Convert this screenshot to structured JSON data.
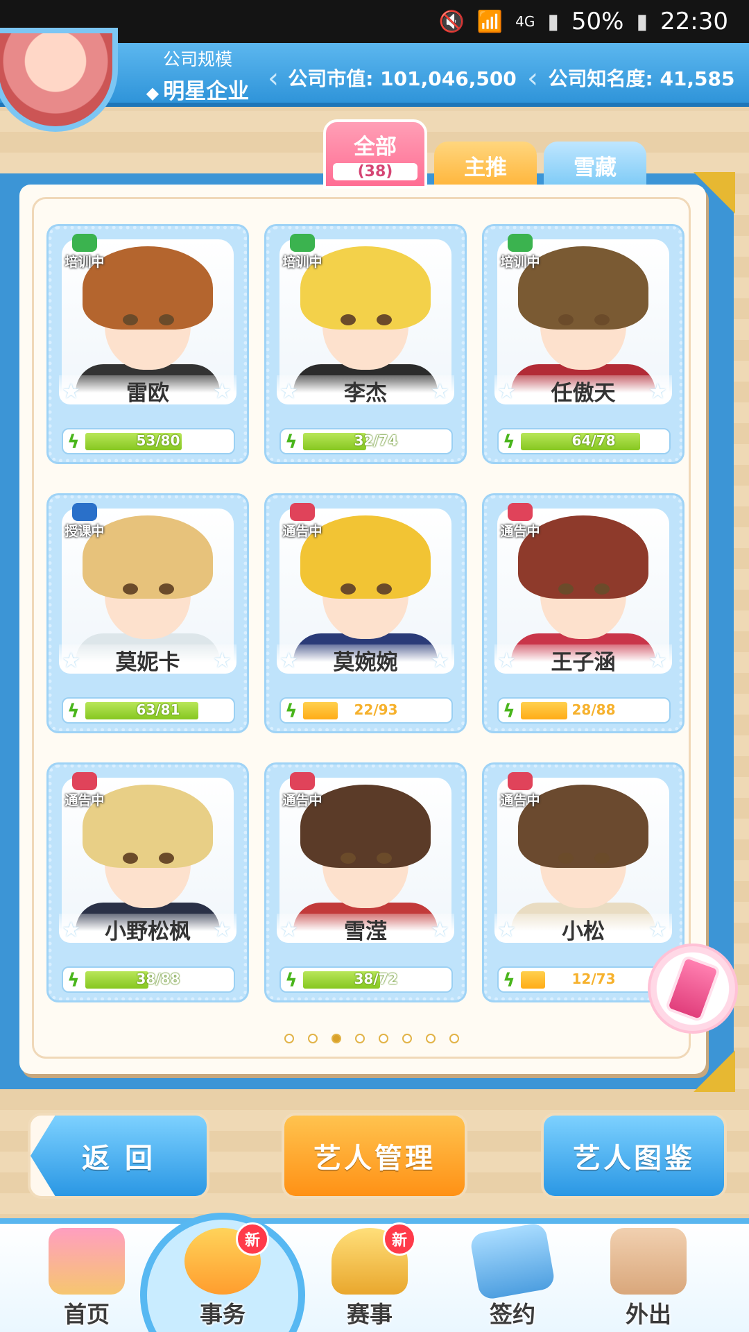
{
  "status_bar": {
    "icons": [
      "mute-icon",
      "wifi-icon",
      "signal-icon",
      "battery-icon"
    ],
    "network": "4G",
    "battery": "50%",
    "time": "22:30"
  },
  "header": {
    "company_scale_label": "公司规模",
    "company_scale_value": "明星企业",
    "market_value": "公司市值: 101,046,500",
    "popularity": "公司知名度: 41,585"
  },
  "tabs": [
    {
      "label": "全部",
      "count": "(38)",
      "active": true
    },
    {
      "label": "主推",
      "active": false
    },
    {
      "label": "雪藏",
      "active": false
    }
  ],
  "artists": [
    {
      "name": "雷欧",
      "status": "培训中",
      "status_type": "training",
      "energy_text": "53/80",
      "energy_fraction": 0.6625,
      "bar": "green",
      "hair": "#b4652e",
      "clothes": "#333333"
    },
    {
      "name": "李杰",
      "status": "培训中",
      "status_type": "training",
      "energy_text": "32/74",
      "energy_fraction": 0.4324,
      "bar": "green",
      "hair": "#f3d14a",
      "clothes": "#2b2b2b"
    },
    {
      "name": "任傲天",
      "status": "培训中",
      "status_type": "training",
      "energy_text": "64/78",
      "energy_fraction": 0.8205,
      "bar": "green",
      "hair": "#7a5a33",
      "clothes": "#b22b36"
    },
    {
      "name": "莫妮卡",
      "status": "授课中",
      "status_type": "teaching",
      "energy_text": "63/81",
      "energy_fraction": 0.7778,
      "bar": "green",
      "hair": "#e7c27b",
      "clothes": "#dde6ea"
    },
    {
      "name": "莫婉婉",
      "status": "通告中",
      "status_type": "notice",
      "energy_text": "22/93",
      "energy_fraction": 0.2366,
      "bar": "orange",
      "hair": "#f2c434",
      "clothes": "#2a3b78"
    },
    {
      "name": "王子涵",
      "status": "通告中",
      "status_type": "notice",
      "energy_text": "28/88",
      "energy_fraction": 0.3182,
      "bar": "orange",
      "hair": "#8e3a2b",
      "clothes": "#c93549"
    },
    {
      "name": "小野松枫",
      "status": "通告中",
      "status_type": "notice",
      "energy_text": "38/88",
      "energy_fraction": 0.4318,
      "bar": "green",
      "hair": "#e8cf86",
      "clothes": "#2a3147"
    },
    {
      "name": "雪滢",
      "status": "通告中",
      "status_type": "notice",
      "energy_text": "38/72",
      "energy_fraction": 0.5278,
      "bar": "green",
      "hair": "#5b3b28",
      "clothes": "#c23a3a"
    },
    {
      "name": "小松",
      "status": "通告中",
      "status_type": "notice",
      "energy_text": "12/73",
      "energy_fraction": 0.1644,
      "bar": "orange",
      "hair": "#6b4a2f",
      "clothes": "#e9dcc2"
    }
  ],
  "pagination": {
    "pages": 8,
    "current": 3
  },
  "actions": {
    "back": "返 回",
    "manage": "艺人管理",
    "gallery": "艺人图鉴"
  },
  "bottom_nav": [
    {
      "label": "首页",
      "new": false,
      "icon": "home-icon"
    },
    {
      "label": "事务",
      "new": true,
      "icon": "affairs-icon"
    },
    {
      "label": "赛事",
      "new": true,
      "icon": "trophy-icon"
    },
    {
      "label": "签约",
      "new": false,
      "icon": "contract-icon"
    },
    {
      "label": "外出",
      "new": false,
      "icon": "door-icon"
    }
  ],
  "new_badge_label": "新"
}
